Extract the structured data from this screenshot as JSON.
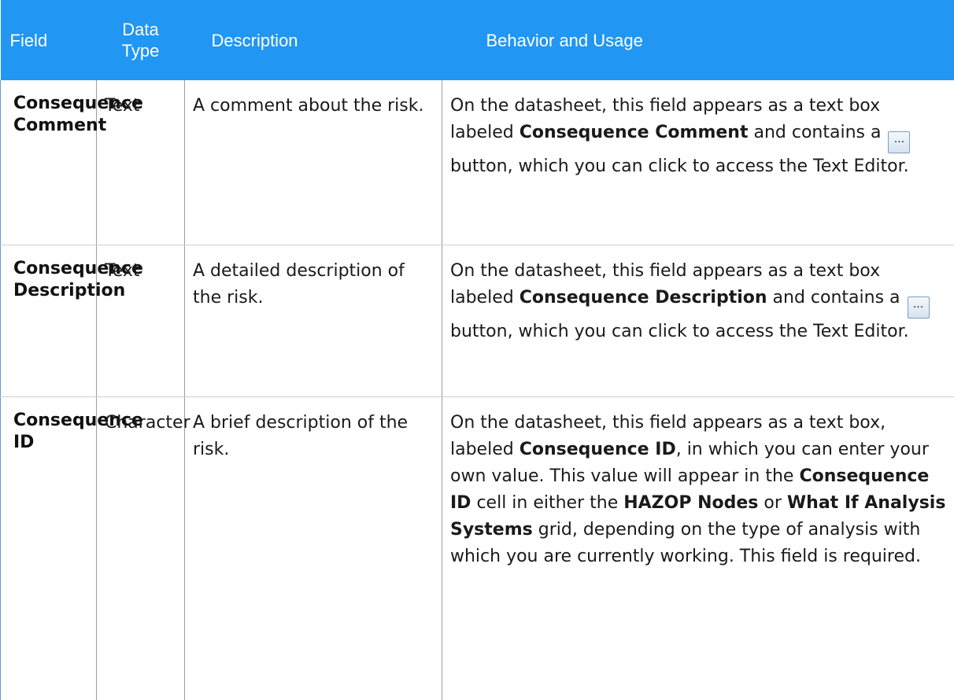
{
  "header": {
    "field": "Field",
    "data_type": "Data Type",
    "description": "Description",
    "behavior": "Behavior and Usage"
  },
  "button_glyph": "...",
  "colors": {
    "header_bg": "#2196f3",
    "header_text": "#ffffff"
  },
  "rows": [
    {
      "field": "Consequence Comment",
      "data_type": "Text",
      "description": "A comment about the risk.",
      "behavior": {
        "t1": "On the datasheet, this field appears as a text box labeled ",
        "b1": "Consequence Comment",
        "t2": " and contains a ",
        "t3": " button, which you can click to access the Text Editor."
      }
    },
    {
      "field": "Consequence Description",
      "data_type": "Text",
      "description": "A detailed description of the risk.",
      "behavior": {
        "t1": "On the datasheet, this field appears as a text box labeled ",
        "b1": "Consequence Description",
        "t2": " and contains a ",
        "t3": " button, which you can click to access the Text Editor."
      }
    },
    {
      "field": "Consequence ID",
      "data_type": "Character",
      "description": "A brief description of the risk.",
      "behavior": {
        "t1": "On the datasheet, this field appears as a text box, labeled ",
        "b1": "Consequence ID",
        "t2": ", in which you can enter your own value. This value will appear in the ",
        "b2": "Consequence ID",
        "t3": " cell in either the ",
        "b3": "HAZOP Nodes",
        "t4": " or ",
        "b4": "What If Analysis Systems",
        "t5": " grid, depending on the type of analysis with which you are currently working. This field is required."
      }
    }
  ]
}
